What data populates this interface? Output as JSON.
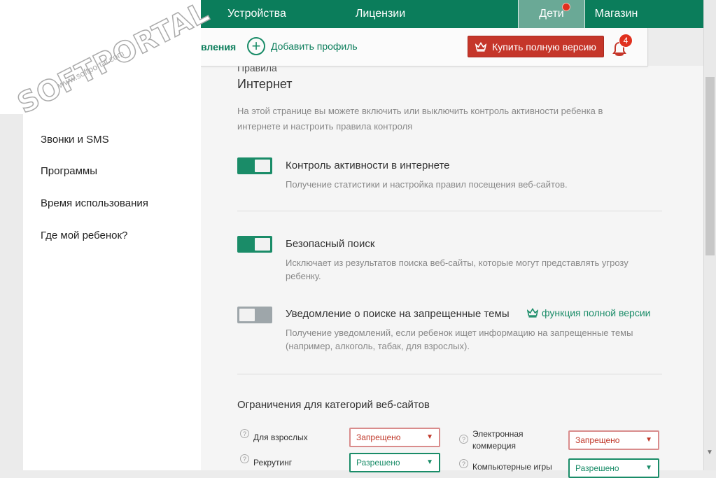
{
  "nav": {
    "tabs": [
      {
        "label": "Устройства"
      },
      {
        "label": "Лицензии"
      },
      {
        "label": "Дети"
      },
      {
        "label": "Магазин"
      }
    ],
    "active_tab": "Дети"
  },
  "toolbar": {
    "partial_label": "вления",
    "add_profile_label": "Добавить профиль",
    "buy_label": "Купить полную версию",
    "notifications_count": "4"
  },
  "watermark": {
    "brand": "SOFTPORTAL",
    "url": "www.softportal.com"
  },
  "sidebar": {
    "items": [
      {
        "label": "Звонки и SMS"
      },
      {
        "label": "Программы"
      },
      {
        "label": "Время использования"
      },
      {
        "label": "Где мой ребенок?"
      }
    ]
  },
  "main": {
    "breadcrumb": "Правила",
    "title": "Интернет",
    "description": "На этой странице вы можете включить или выключить контроль активности ребенка в интернете и настроить правила контроля",
    "options": [
      {
        "title": "Контроль активности в интернете",
        "description": "Получение статистики и настройка правил посещения веб-сайтов.",
        "enabled": true
      },
      {
        "title": "Безопасный поиск",
        "description": "Исключает из результатов поиска веб-сайты, которые могут представлять угрозу ребенку.",
        "enabled": true
      },
      {
        "title": "Уведомление о поиске на запрещенные темы",
        "description": "Получение уведомлений, если ребенок ищет информацию на запрещенные темы (например, алкоголь, табак, для взрослых).",
        "enabled": false
      }
    ],
    "full_version_label": "функция полной версии",
    "categories_title": "Ограничения для категорий веб-сайтов",
    "categories": [
      {
        "label": "Для взрослых",
        "value": "Запрещено"
      },
      {
        "label": "Электронная коммерция",
        "value": "Запрещено"
      },
      {
        "label": "Рекрутинг",
        "value": "Разрешено"
      },
      {
        "label": "Компьютерные игры",
        "value": "Разрешено"
      }
    ]
  },
  "colors": {
    "brand_green": "#0b7d5b",
    "accent_red": "#c5362a",
    "toggle_on": "#1a8c68",
    "toggle_off": "#9ea6aa"
  }
}
